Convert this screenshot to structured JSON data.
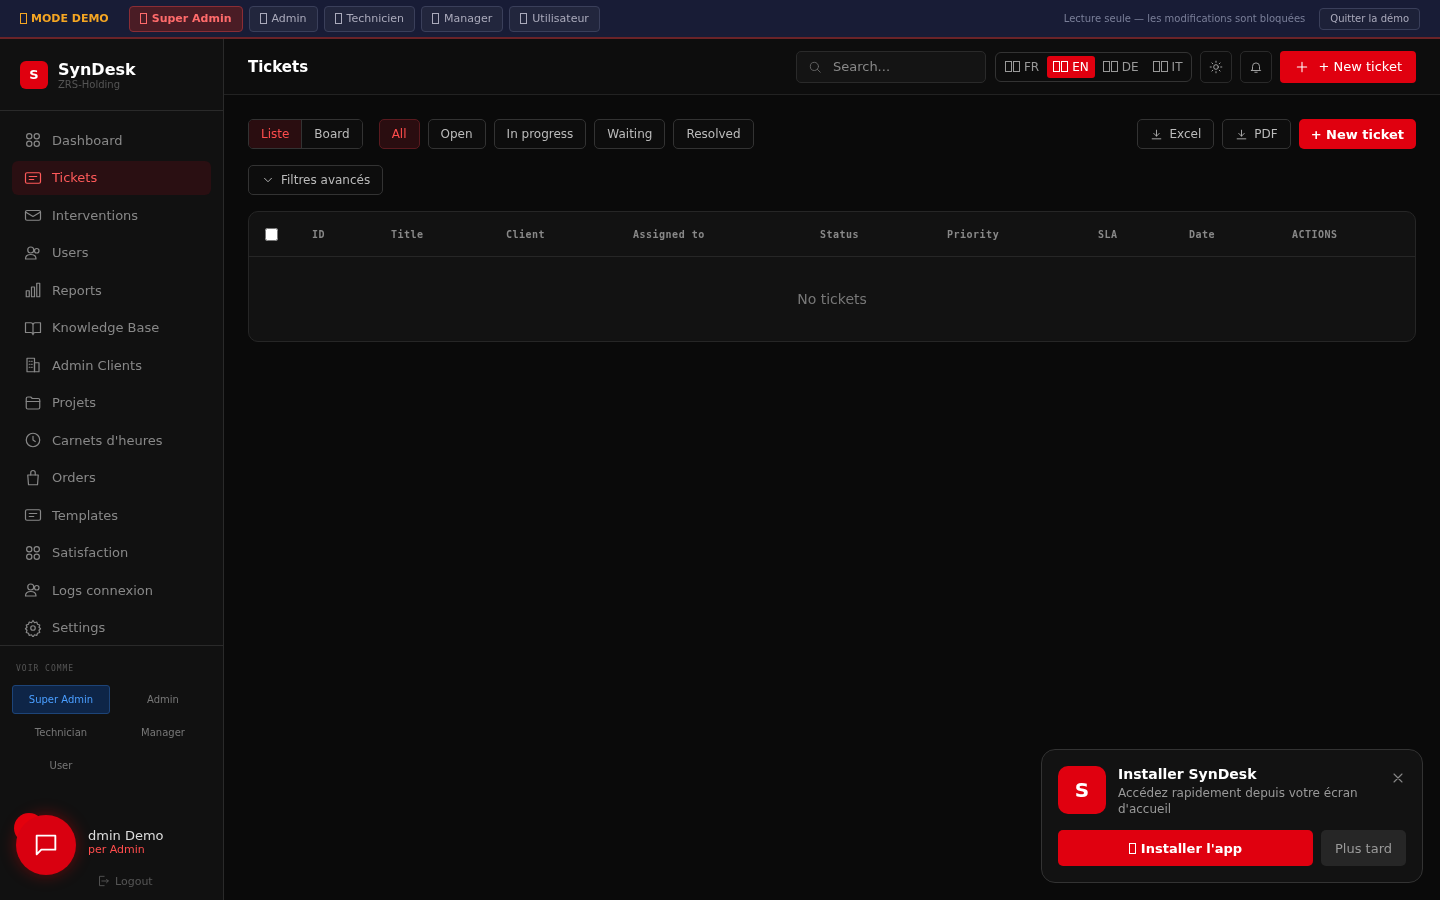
{
  "demo_bar": {
    "mode_label": "MODE DEMO",
    "roles": [
      {
        "label": "Super Admin",
        "selected": true
      },
      {
        "label": "Admin",
        "selected": false
      },
      {
        "label": "Technicien",
        "selected": false
      },
      {
        "label": "Manager",
        "selected": false
      },
      {
        "label": "Utilisateur",
        "selected": false
      }
    ],
    "notice": "Lecture seule — les modifications sont bloquées",
    "quit_button": "Quitter la démo"
  },
  "sidebar": {
    "brand": {
      "logo": "S",
      "name": "SynDesk",
      "company": "ZRS-Holding"
    },
    "items": [
      {
        "label": "Dashboard",
        "selected": false
      },
      {
        "label": "Tickets",
        "selected": true
      },
      {
        "label": "Interventions",
        "selected": false
      },
      {
        "label": "Users",
        "selected": false
      },
      {
        "label": "Reports",
        "selected": false
      },
      {
        "label": "Knowledge Base",
        "selected": false
      },
      {
        "label": "Admin Clients",
        "selected": false
      },
      {
        "label": "Projets",
        "selected": false
      },
      {
        "label": "Carnets d'heures",
        "selected": false
      },
      {
        "label": "Orders",
        "selected": false
      },
      {
        "label": "Templates",
        "selected": false
      },
      {
        "label": "Satisfaction",
        "selected": false
      },
      {
        "label": "Logs connexion",
        "selected": false
      },
      {
        "label": "Settings",
        "selected": false
      }
    ],
    "view_as": {
      "title": "VOIR COMME",
      "roles": [
        {
          "label": "Super Admin",
          "selected": true
        },
        {
          "label": "Admin",
          "selected": false
        },
        {
          "label": "Technician",
          "selected": false
        },
        {
          "label": "Manager",
          "selected": false
        },
        {
          "label": "User",
          "selected": false
        }
      ]
    },
    "user": {
      "name": "dmin Demo",
      "role": "per Admin"
    },
    "logout": "Logout"
  },
  "header": {
    "title": "Tickets",
    "search": {
      "placeholder": "Search..."
    },
    "languages": [
      {
        "label": "FR",
        "selected": false
      },
      {
        "label": "EN",
        "selected": true
      },
      {
        "label": "DE",
        "selected": false
      },
      {
        "label": "IT",
        "selected": false
      }
    ],
    "new_ticket_button": "+ New ticket"
  },
  "toolbar": {
    "views": [
      {
        "label": "Liste",
        "selected": true
      },
      {
        "label": "Board",
        "selected": false
      }
    ],
    "filters": [
      {
        "label": "All",
        "selected": true
      },
      {
        "label": "Open",
        "selected": false
      },
      {
        "label": "In progress",
        "selected": false
      },
      {
        "label": "Waiting",
        "selected": false
      },
      {
        "label": "Resolved",
        "selected": false
      }
    ],
    "exports": [
      "Excel",
      "PDF"
    ],
    "new_ticket_button": "+ New ticket",
    "advanced_filters": "Filtres avancés"
  },
  "table": {
    "select_all": {
      "checked": false
    },
    "columns": [
      "ID",
      "Title",
      "Client",
      "Assigned to",
      "Status",
      "Priority",
      "SLA",
      "Date",
      "ACTIONS"
    ],
    "empty_text": "No tickets"
  },
  "install_prompt": {
    "logo": "S",
    "title": "Installer SynDesk",
    "description": "Accédez rapidement depuis votre écran d'accueil",
    "install_button": "Installer l'app",
    "later_button": "Plus tard"
  }
}
